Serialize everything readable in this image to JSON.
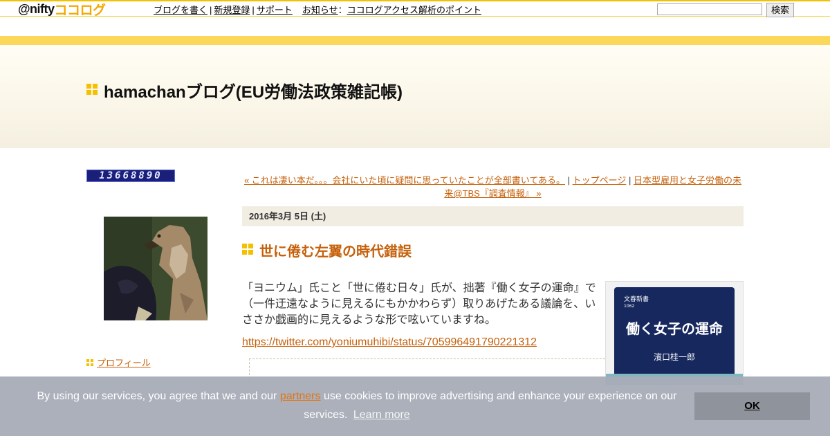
{
  "topbar": {
    "logo_text": "@nifty",
    "logo_cocolog": "ココログ",
    "nav": {
      "write_blog": "ブログを書く",
      "register": "新規登録",
      "support": "サポート",
      "news_label": "お知らせ",
      "news_colon": "：",
      "news_link": "ココログアクセス解析のポイント"
    },
    "search_button": "検索",
    "search_value": ""
  },
  "header": {
    "blog_title": "hamachanブログ(EU労働法政策雑記帳)"
  },
  "sidebar": {
    "access_counter": "13668890",
    "profile_link": "プロフィール"
  },
  "post_nav": {
    "prev": "« これは凄い本だ。。。会社にいた頃に疑問に思っていたことが全部書いてある。",
    "top": "トップページ",
    "next": "日本型雇用と女子労働の未来@TBS『調査情報』 »",
    "separator": "|"
  },
  "post": {
    "date": "2016年3月 5日 (土)",
    "title": "世に倦む左翼の時代錯誤",
    "body": "「ヨニウム」氏こと「世に倦む日々」氏が、拙著『働く女子の運命』で（一件迂遠なように見えるにもかかわらず）取りあげたある議論を、いささか戯画的に見えるような形で呟いていますね。",
    "link": "https://twitter.com/yoniumuhibi/status/705996491790221312",
    "book": {
      "series": "文春新書",
      "number": "1062",
      "title": "働く女子の運命",
      "author": "濱口桂一郎"
    }
  },
  "cookie": {
    "text_before": "By using our services, you agree that we and our",
    "partners": "partners",
    "text_after": "use cookies to improve advertising and enhance your experience on our services.",
    "learn_more": "Learn more",
    "ok": "OK"
  },
  "colors": {
    "accent_orange": "#c6600a",
    "brand_yellow": "#f5c000"
  }
}
